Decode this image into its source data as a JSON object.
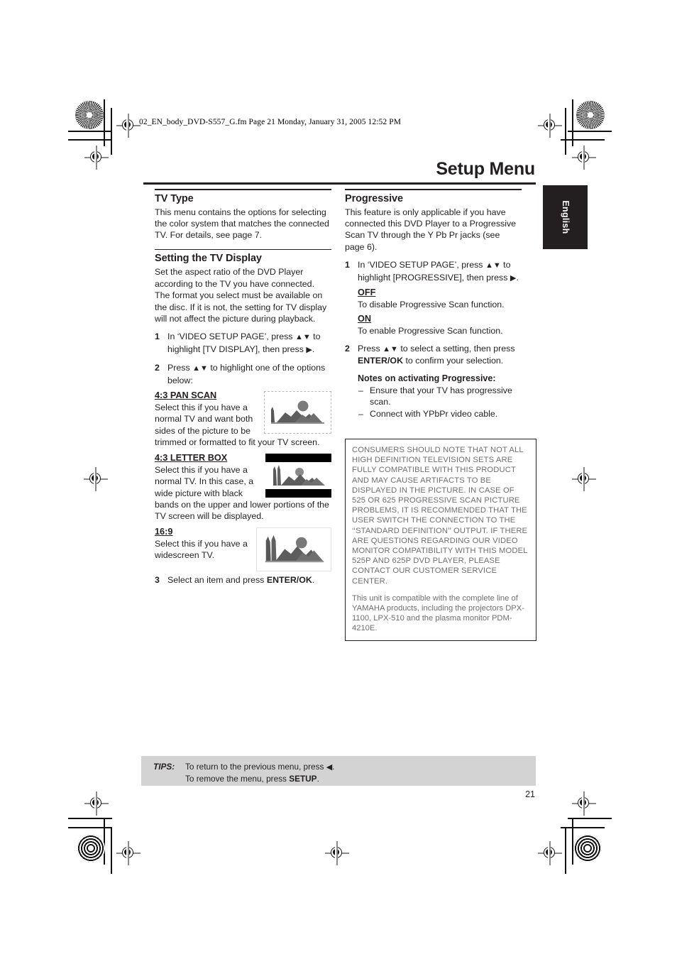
{
  "print_marks": {
    "file_stamp": "02_EN_body_DVD-S557_G.fm  Page 21  Monday, January 31, 2005  12:52 PM"
  },
  "header": {
    "title": "Setup Menu",
    "language_tab": "English",
    "page_number": "21"
  },
  "left_column": {
    "tv_type": {
      "heading": "TV Type",
      "body": "This menu contains the options for selecting the color system that matches the connected TV. For details, see page 7."
    },
    "tv_display": {
      "heading": "Setting the TV Display",
      "body": "Set the aspect ratio of the DVD Player according to the TV you have connected. The format you select must be available on the disc. If it is not, the setting for TV display will not affect the picture during playback.",
      "step1_num": "1",
      "step1_a": "In ‘VIDEO SETUP PAGE’, press ",
      "step1_updown": "▲▼",
      "step1_b": " to highlight [TV DISPLAY], then press ",
      "step1_right": "▶",
      "step1_c": ".",
      "step2_num": "2",
      "step2_a": "Press ",
      "step2_updown": "▲▼",
      "step2_b": " to highlight one of the options below:",
      "options": [
        {
          "title": "4:3 PAN SCAN",
          "text": "Select this if you have a normal TV and want both sides of the picture to be trimmed or formatted to fit your TV screen."
        },
        {
          "title": "4:3 LETTER BOX",
          "text": "Select this if you have a normal TV. In this case, a wide picture with black bands on the upper and lower portions of the TV screen will be displayed."
        },
        {
          "title": "16:9",
          "text": "Select this if you have a widescreen TV."
        }
      ],
      "step3_num": "3",
      "step3_a": "Select an item and press ",
      "step3_bold": "ENTER/OK",
      "step3_b": "."
    }
  },
  "right_column": {
    "progressive": {
      "heading": "Progressive",
      "body": "This feature is only applicable if you have connected this DVD Player to a Progressive Scan TV through the Y Pb Pr jacks (see page 6).",
      "step1_num": "1",
      "step1_a": "In ‘VIDEO SETUP PAGE’, press ",
      "step1_updown": "▲▼",
      "step1_b": " to highlight [PROGRESSIVE], then press ",
      "step1_right": "▶",
      "step1_c": ".",
      "off_title": "OFF",
      "off_text": "To disable Progressive Scan function.",
      "on_title": "ON",
      "on_text": "To enable Progressive Scan function.",
      "step2_num": "2",
      "step2_a": "Press ",
      "step2_updown": "▲▼",
      "step2_b": " to select a setting, then press ",
      "step2_bold": "ENTER/OK",
      "step2_c": " to confirm your selection.",
      "notes_heading": "Notes on activating Progressive:",
      "notes": [
        "Ensure that your TV has progressive scan.",
        "Connect with YPbPr video cable."
      ]
    },
    "legal_box": {
      "paragraph1": "CONSUMERS SHOULD NOTE THAT NOT ALL HIGH DEFINITION TELEVISION SETS ARE FULLY COMPATIBLE WITH THIS PRODUCT AND MAY CAUSE ARTIFACTS TO BE DISPLAYED IN THE PICTURE. IN CASE OF 525 OR 625 PROGRESSIVE SCAN PICTURE PROBLEMS, IT IS RECOMMENDED THAT THE USER SWITCH THE CONNECTION TO THE ‘‘STANDARD DEFINITION’’ OUTPUT. IF THERE ARE QUESTIONS REGARDING OUR VIDEO MONITOR COMPATIBILITY WITH THIS MODEL 525P AND 625P DVD PLAYER, PLEASE CONTACT OUR CUSTOMER SERVICE CENTER.",
      "paragraph2": "This unit is compatible with the complete line of YAMAHA products, including the projectors DPX-1100, LPX-510 and the plasma monitor PDM-4210E."
    }
  },
  "tips": {
    "label": "TIPS:",
    "line1_a": "To return to the previous menu, press ",
    "line1_arrow": "◀",
    "line1_b": ".",
    "line2_a": "To remove the menu, press ",
    "line2_bold": "SETUP",
    "line2_b": "."
  },
  "colors": {
    "ink": "#231f20",
    "legal_text": "#6d6e71",
    "tips_background": "#d3d3d3"
  }
}
